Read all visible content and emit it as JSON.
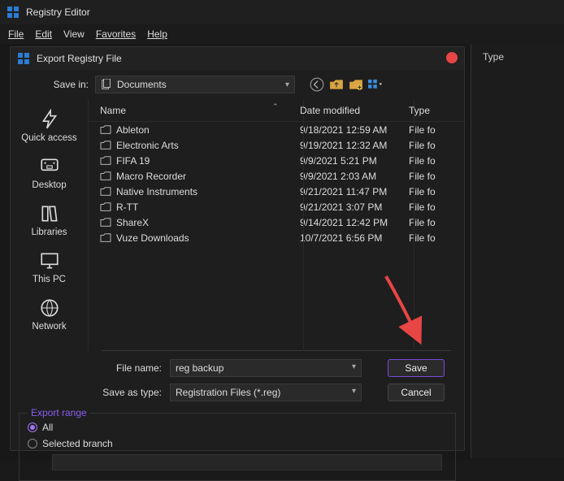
{
  "app": {
    "title": "Registry Editor"
  },
  "menu": {
    "file": "File",
    "edit": "Edit",
    "view": "View",
    "favorites": "Favorites",
    "help": "Help"
  },
  "right_panel": {
    "col_type": "Type"
  },
  "dialog": {
    "title": "Export Registry File",
    "save_in_label": "Save in:",
    "save_in_value": "Documents",
    "columns": {
      "name": "Name",
      "date": "Date modified",
      "type": "Type"
    },
    "places": {
      "quick_access": "Quick access",
      "desktop": "Desktop",
      "libraries": "Libraries",
      "this_pc": "This PC",
      "network": "Network"
    },
    "files": [
      {
        "name": "Ableton",
        "date": "9/18/2021 12:59 AM",
        "type": "File fo"
      },
      {
        "name": "Electronic Arts",
        "date": "9/19/2021 12:32 AM",
        "type": "File fo"
      },
      {
        "name": "FIFA 19",
        "date": "9/9/2021 5:21 PM",
        "type": "File fo"
      },
      {
        "name": "Macro Recorder",
        "date": "9/9/2021 2:03 AM",
        "type": "File fo"
      },
      {
        "name": "Native Instruments",
        "date": "9/21/2021 11:47 PM",
        "type": "File fo"
      },
      {
        "name": "R-TT",
        "date": "9/21/2021 3:07 PM",
        "type": "File fo"
      },
      {
        "name": "ShareX",
        "date": "9/14/2021 12:42 PM",
        "type": "File fo"
      },
      {
        "name": "Vuze Downloads",
        "date": "10/7/2021 6:56 PM",
        "type": "File fo"
      }
    ],
    "file_name_label": "File name:",
    "file_name_value": "reg backup",
    "save_as_type_label": "Save as type:",
    "save_as_type_value": "Registration Files (*.reg)",
    "save_button": "Save",
    "cancel_button": "Cancel",
    "export_range": {
      "legend": "Export range",
      "all": "All",
      "selected_branch": "Selected branch"
    }
  }
}
